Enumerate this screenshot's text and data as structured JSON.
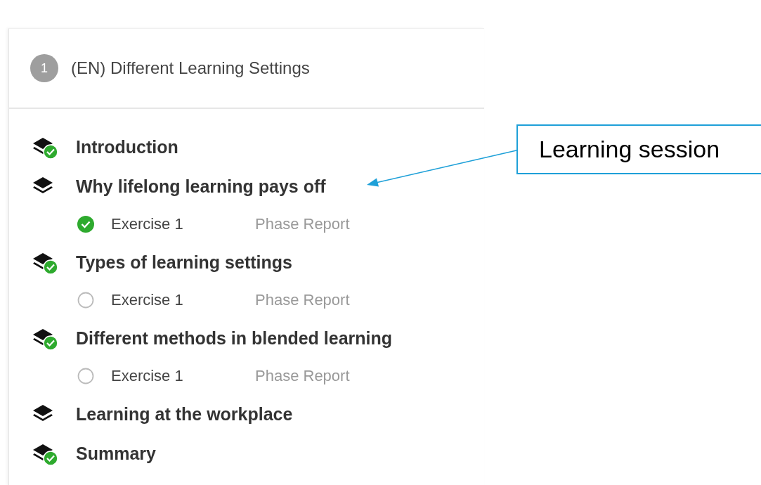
{
  "course": {
    "number": "1",
    "title": "(EN) Different Learning Settings"
  },
  "sessions": [
    {
      "title": "Introduction",
      "completed": true
    },
    {
      "title": "Why lifelong learning pays off",
      "completed": false,
      "exercises": [
        {
          "label": "Exercise 1",
          "report": "Phase Report",
          "done": true
        }
      ]
    },
    {
      "title": "Types of learning settings",
      "completed": true,
      "exercises": [
        {
          "label": "Exercise 1",
          "report": "Phase Report",
          "done": false
        }
      ]
    },
    {
      "title": "Different methods in blended learning",
      "completed": true,
      "exercises": [
        {
          "label": "Exercise 1",
          "report": "Phase Report",
          "done": false
        }
      ]
    },
    {
      "title": "Learning at the workplace",
      "completed": false
    },
    {
      "title": "Summary",
      "completed": true
    }
  ],
  "callout": {
    "text": "Learning session"
  }
}
